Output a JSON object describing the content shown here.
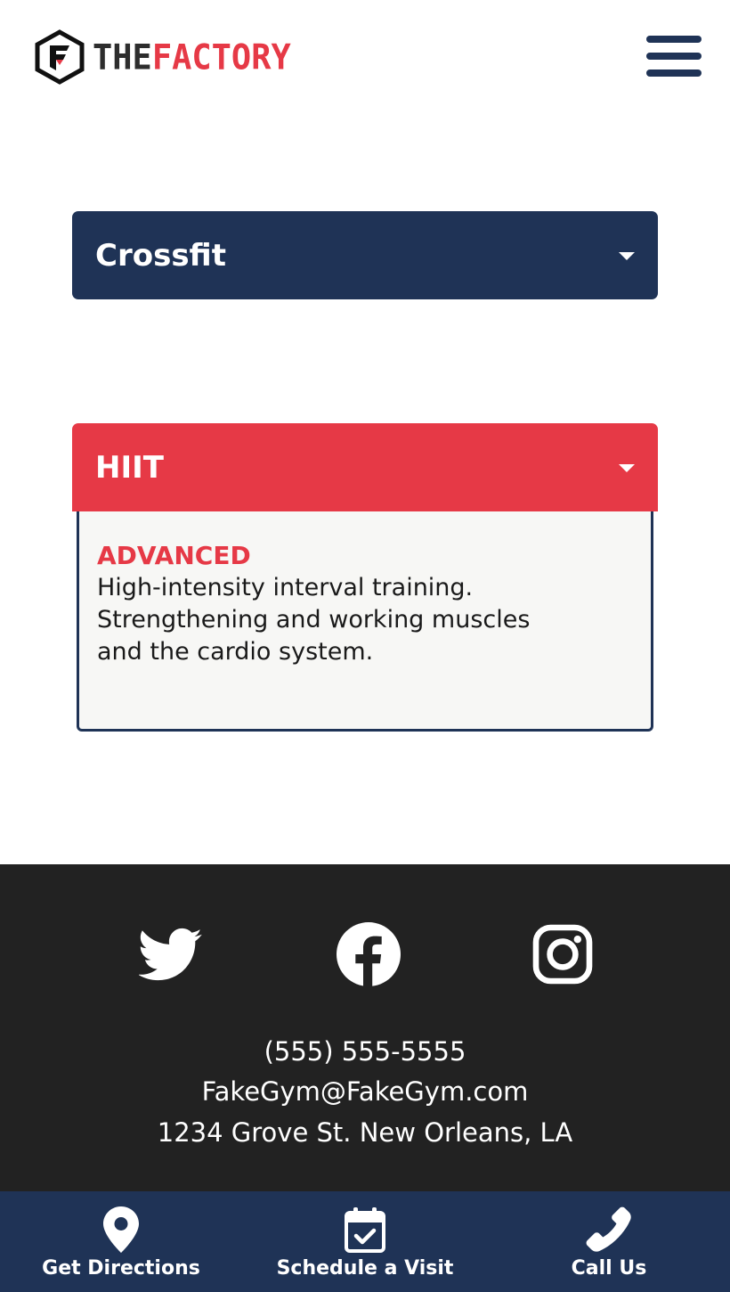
{
  "brand": {
    "part1": "THE",
    "part2": "FACTORY",
    "color_dark": "#2d2d2d",
    "color_accent": "#e63946"
  },
  "header": {
    "menu_icon": "hamburger-menu-icon"
  },
  "classes": [
    {
      "title": "Crossfit",
      "expanded": false,
      "color": "#1f3356",
      "icon": "caret-down-icon"
    },
    {
      "title": "HIIT",
      "expanded": true,
      "color": "#e63946",
      "icon": "caret-down-icon",
      "level": "ADVANCED",
      "description": "High-intensity interval training. Strengthening and working muscles and the cardio system."
    }
  ],
  "social": [
    {
      "name": "twitter",
      "icon": "twitter-icon"
    },
    {
      "name": "facebook",
      "icon": "facebook-icon"
    },
    {
      "name": "instagram",
      "icon": "instagram-icon"
    }
  ],
  "contact": {
    "phone": "(555) 555-5555",
    "email": "FakeGym@FakeGym.com",
    "address": "1234 Grove St. New Orleans, LA"
  },
  "bottom_nav": [
    {
      "label": "Get Directions",
      "icon": "map-pin-icon"
    },
    {
      "label": "Schedule a Visit",
      "icon": "calendar-check-icon"
    },
    {
      "label": "Call Us",
      "icon": "phone-icon"
    }
  ],
  "colors": {
    "navy": "#1f3356",
    "red": "#e63946",
    "footer": "#222222",
    "panel": "#f7f7f5"
  }
}
